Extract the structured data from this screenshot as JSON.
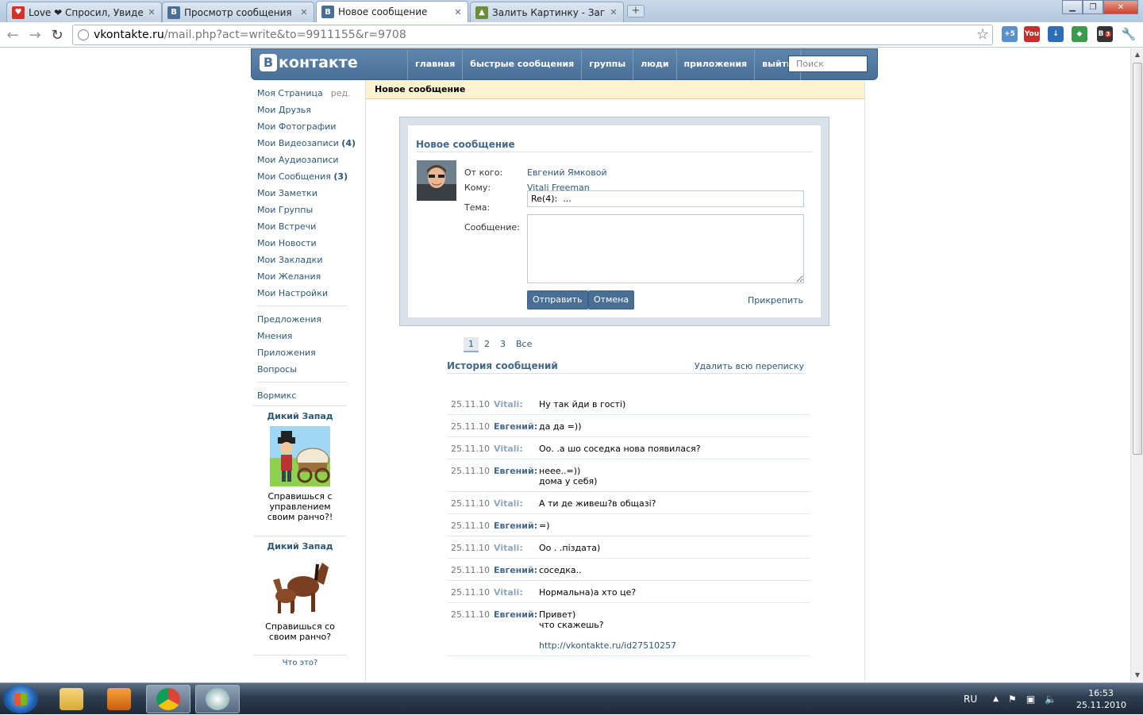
{
  "browser": {
    "tabs": [
      {
        "title": "Love ❤ Спросил, Увиде...",
        "favicon": "heart-icon",
        "color": "#d93025"
      },
      {
        "title": "Просмотр сообщения",
        "favicon": "vk-icon",
        "color": "#4a6f97"
      },
      {
        "title": "Новое сообщение",
        "favicon": "vk-icon",
        "color": "#4a6f97",
        "active": true
      },
      {
        "title": "Залить Картинку - Загру...",
        "favicon": "image-icon",
        "color": "#6b8e3b"
      }
    ],
    "url_host": "vkontakte.ru",
    "url_path": "/mail.php?act=write&to=9911155&r=9708",
    "ext_badge_1": "+5",
    "ext_badge_2": "3"
  },
  "vk": {
    "logo": "контакте",
    "nav": [
      "главная",
      "быстрые сообщения",
      "группы",
      "люди",
      "приложения",
      "выйти"
    ],
    "search_placeholder": "Поиск"
  },
  "leftmenu": {
    "my_page": "Моя Страница",
    "edit": "ред.",
    "items": [
      {
        "label": "Мои Друзья"
      },
      {
        "label": "Мои Фотографии"
      },
      {
        "label": "Мои Видеозаписи",
        "count": "(4)"
      },
      {
        "label": "Мои Аудиозаписи"
      },
      {
        "label": "Мои Сообщения",
        "count": "(3)"
      },
      {
        "label": "Мои Заметки"
      },
      {
        "label": "Мои Группы"
      },
      {
        "label": "Мои Встречи"
      },
      {
        "label": "Мои Новости"
      },
      {
        "label": "Мои Закладки"
      },
      {
        "label": "Мои Желания"
      },
      {
        "label": "Мои Настройки"
      }
    ],
    "items2": [
      "Предложения",
      "Мнения",
      "Приложения",
      "Вопросы"
    ],
    "items3": [
      "Вормикс"
    ]
  },
  "ads": [
    {
      "title": "Дикий Запад",
      "text": "Справишься с управлением своим ранчо?!"
    },
    {
      "title": "Дикий Запад",
      "text": "Справишься со своим ранчо?"
    }
  ],
  "what_is": "Что это?",
  "main": {
    "bar_title": "Новое сообщение",
    "compose": {
      "title": "Новое сообщение",
      "from_label": "От кого:",
      "from_value": "Евгений Ямковой",
      "to_label": "Кому:",
      "to_value": "Vitali Freeman",
      "subject_label": "Тема:",
      "subject_value": "Re(4):  ...",
      "message_label": "Сообщение:",
      "send": "Отправить",
      "cancel": "Отмена",
      "attach": "Прикрепить"
    },
    "pager": [
      "1",
      "2",
      "3",
      "Все"
    ],
    "history_title": "История сообщений",
    "delete_all": "Удалить всю переписку",
    "messages": [
      {
        "date": "25.11.10",
        "author": "Vitali:",
        "who": "v",
        "text": "Ну так йди в гості)"
      },
      {
        "date": "25.11.10",
        "author": "Евгений:",
        "who": "e",
        "text": "да да =))"
      },
      {
        "date": "25.11.10",
        "author": "Vitali:",
        "who": "v",
        "text": "Оо. .а шо соседка нова появилася?"
      },
      {
        "date": "25.11.10",
        "author": "Евгений:",
        "who": "e",
        "text": "неее..=))\nдома у себя)"
      },
      {
        "date": "25.11.10",
        "author": "Vitali:",
        "who": "v",
        "text": "А ти де живеш?в общазі?"
      },
      {
        "date": "25.11.10",
        "author": "Евгений:",
        "who": "e",
        "text": "=)"
      },
      {
        "date": "25.11.10",
        "author": "Vitali:",
        "who": "v",
        "text": "Оо . .піздата)"
      },
      {
        "date": "25.11.10",
        "author": "Евгений:",
        "who": "e",
        "text": "соседка.."
      },
      {
        "date": "25.11.10",
        "author": "Vitali:",
        "who": "v",
        "text": "Нормальна)а хто це?"
      },
      {
        "date": "25.11.10",
        "author": "Евгений:",
        "who": "e",
        "text": "Привет)\nчто скажешь?",
        "link": "http://vkontakte.ru/id27510257"
      }
    ]
  },
  "taskbar": {
    "lang": "RU",
    "time": "16:53",
    "date": "25.11.2010"
  }
}
